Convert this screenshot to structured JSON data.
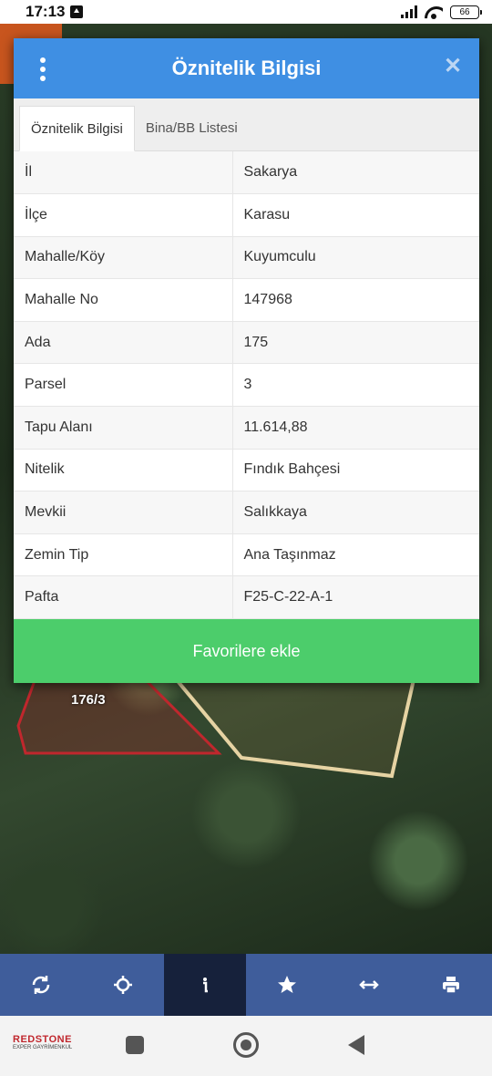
{
  "status_bar": {
    "time": "17:13",
    "battery": "66"
  },
  "map": {
    "parcel_label": "176/3"
  },
  "dialog": {
    "title": "Öznitelik Bilgisi",
    "tabs": [
      {
        "label": "Öznitelik Bilgisi",
        "active": true
      },
      {
        "label": "Bina/BB Listesi",
        "active": false
      }
    ],
    "rows": [
      {
        "key": "İl",
        "value": "Sakarya"
      },
      {
        "key": "İlçe",
        "value": "Karasu"
      },
      {
        "key": "Mahalle/Köy",
        "value": "Kuyumculu"
      },
      {
        "key": "Mahalle No",
        "value": "147968"
      },
      {
        "key": "Ada",
        "value": "175"
      },
      {
        "key": "Parsel",
        "value": "3"
      },
      {
        "key": "Tapu Alanı",
        "value": "11.614,88"
      },
      {
        "key": "Nitelik",
        "value": "Fındık Bahçesi"
      },
      {
        "key": "Mevkii",
        "value": "Salıkkaya"
      },
      {
        "key": "Zemin Tip",
        "value": "Ana Taşınmaz"
      },
      {
        "key": "Pafta",
        "value": "F25-C-22-A-1"
      }
    ],
    "favorite_button": "Favorilere ekle"
  },
  "toolbar": {
    "items": [
      {
        "icon": "refresh-icon"
      },
      {
        "icon": "locate-icon"
      },
      {
        "icon": "info-icon",
        "active": true
      },
      {
        "icon": "star-icon"
      },
      {
        "icon": "measure-icon"
      },
      {
        "icon": "print-icon"
      }
    ]
  },
  "logo": {
    "main": "REDSTONE",
    "sub": "EXPER GAYRİMENKUL"
  },
  "colors": {
    "header": "#3f8fe3",
    "favorite": "#4ccd6b",
    "toolbar": "#3f5d9b",
    "toolbar_active": "#16213b"
  }
}
